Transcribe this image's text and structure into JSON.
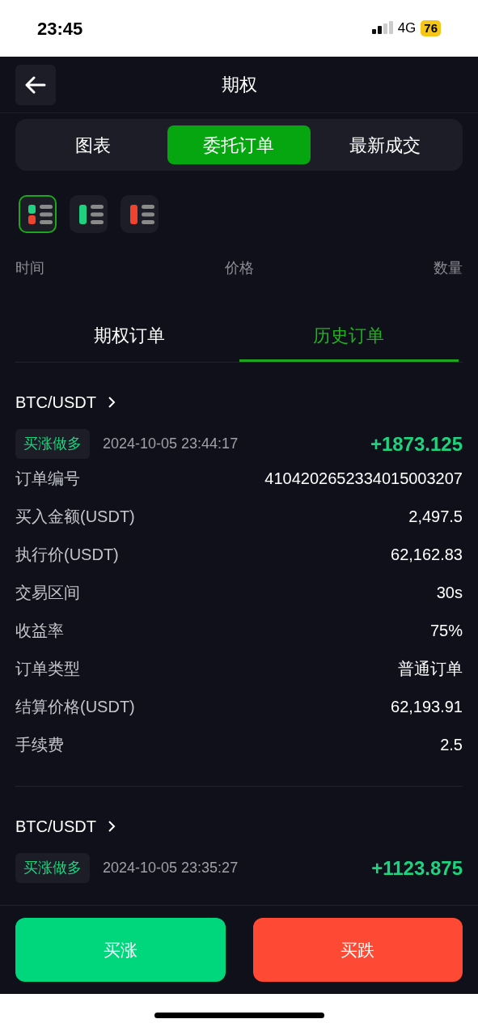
{
  "status_bar": {
    "time": "23:45",
    "network": "4G",
    "battery": "76"
  },
  "header": {
    "title": "期权"
  },
  "tabs": [
    {
      "label": "图表",
      "selected": false
    },
    {
      "label": "委托订单",
      "selected": true
    },
    {
      "label": "最新成交",
      "selected": false
    }
  ],
  "layout_modes": [
    {
      "kind": "both",
      "selected": true
    },
    {
      "kind": "buy",
      "selected": false
    },
    {
      "kind": "sell",
      "selected": false
    }
  ],
  "columns": [
    "时间",
    "价格",
    "数量"
  ],
  "sub_tabs": [
    {
      "label": "期权订单",
      "selected": false
    },
    {
      "label": "历史订单",
      "selected": true
    }
  ],
  "orders": [
    {
      "pair": "BTC/USDT",
      "side": "买涨做多",
      "time": "2024-10-05 23:44:17",
      "pnl": "+1873.125",
      "fields": [
        {
          "label": "订单编号",
          "value": "4104202652334015003207"
        },
        {
          "label": "买入金额(USDT)",
          "value": "2,497.5"
        },
        {
          "label": "执行价(USDT)",
          "value": "62,162.83"
        },
        {
          "label": "交易区间",
          "value": "30s"
        },
        {
          "label": "收益率",
          "value": "75%"
        },
        {
          "label": "订单类型",
          "value": "普通订单"
        },
        {
          "label": "结算价格(USDT)",
          "value": "62,193.91"
        },
        {
          "label": "手续费",
          "value": "2.5"
        }
      ]
    },
    {
      "pair": "BTC/USDT",
      "side": "买涨做多",
      "time": "2024-10-05 23:35:27",
      "pnl": "+1123.875"
    }
  ],
  "actions": [
    {
      "label": "买涨",
      "kind": "buy"
    },
    {
      "label": "买跌",
      "kind": "sell"
    }
  ]
}
